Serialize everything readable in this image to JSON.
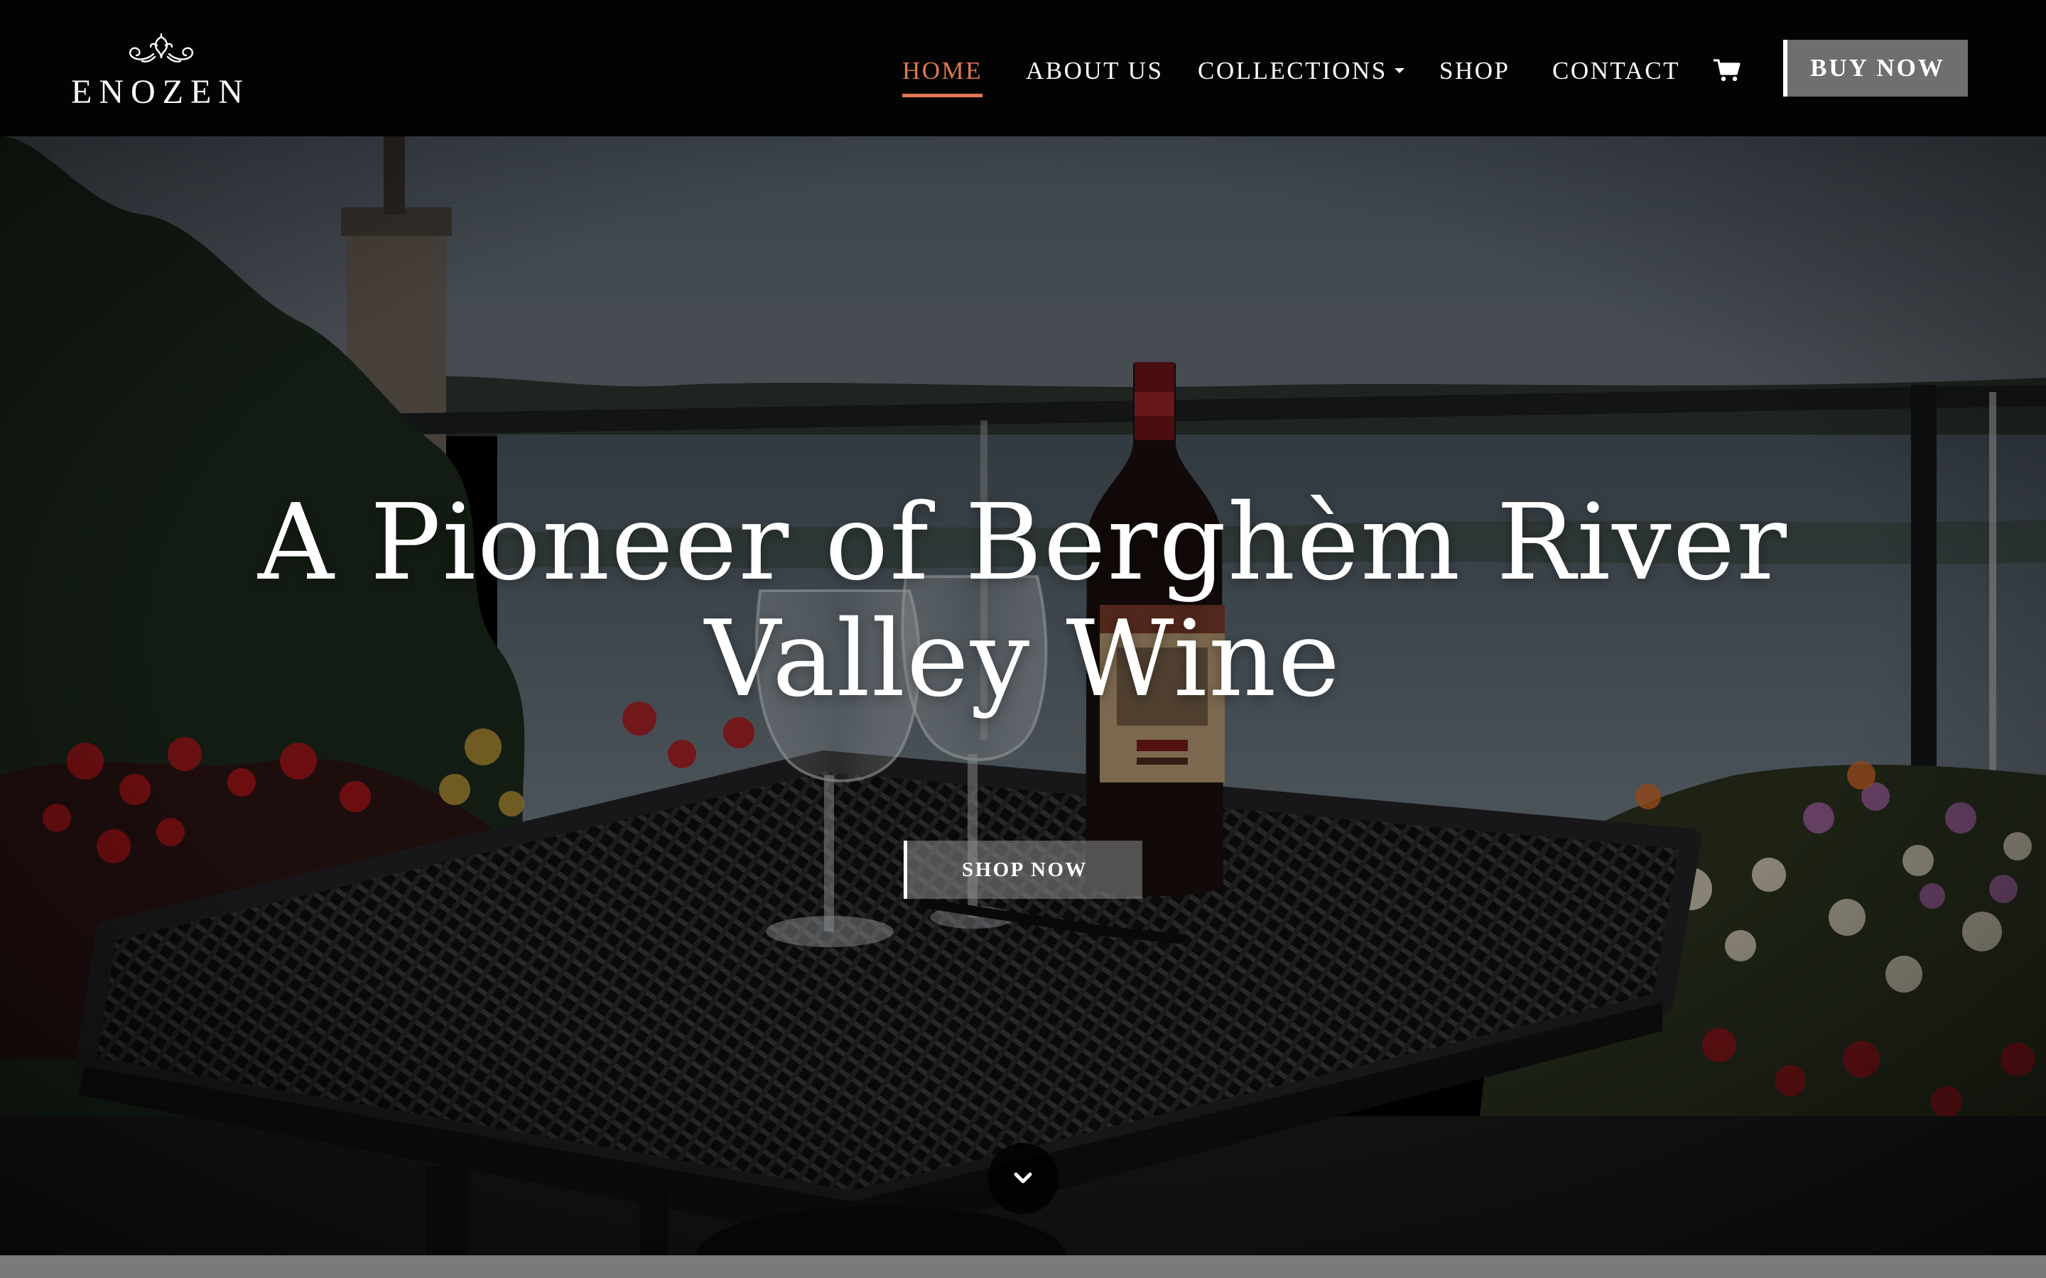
{
  "brand": {
    "name": "ENOZEN",
    "logo_icon": "grape-leaf-ornament-icon"
  },
  "nav": {
    "items": [
      {
        "label": "HOME",
        "active": true
      },
      {
        "label": "ABOUT US",
        "active": false
      },
      {
        "label": "COLLECTIONS",
        "active": false,
        "has_dropdown": true
      },
      {
        "label": "SHOP",
        "active": false
      },
      {
        "label": "CONTACT",
        "active": false
      }
    ],
    "cart_icon": "shopping-cart-icon",
    "buy_button": "BUY NOW"
  },
  "hero": {
    "title_line1": "A Pioneer of Berghèm River",
    "title_line2": "Valley Wine",
    "cta": "SHOP NOW",
    "scroll_icon": "chevron-down-icon",
    "background": "wine-bottle-and-glasses-on-patio-table"
  },
  "colors": {
    "accent": "#e2774f",
    "header_bg": "#030303",
    "button_bg": "#6f6f6f"
  }
}
